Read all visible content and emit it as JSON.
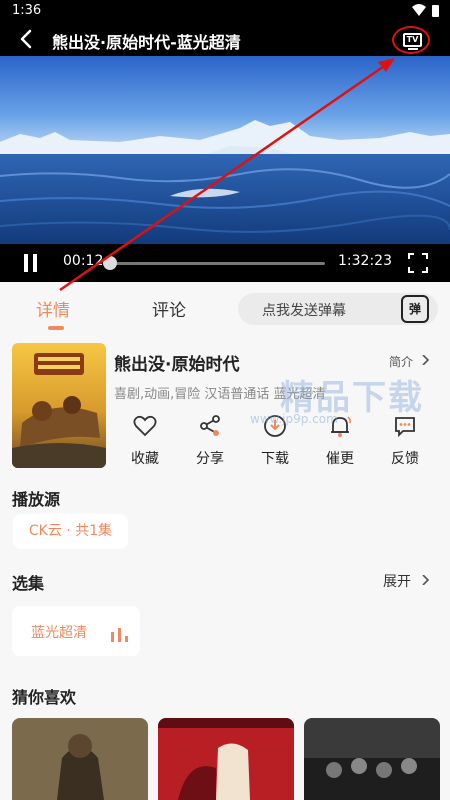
{
  "status_bar": {
    "time": "1:36"
  },
  "header": {
    "title": "熊出没·原始时代-蓝光超清",
    "cast_icon_text": "TV"
  },
  "player": {
    "current_time": "00:12",
    "total_time": "1:32:23",
    "progress_fraction": 0.0022
  },
  "tabs": [
    {
      "label": "详情",
      "active": true
    },
    {
      "label": "评论",
      "active": false
    }
  ],
  "danmaku": {
    "placeholder": "点我发送弹幕",
    "icon_text": "弹"
  },
  "movie": {
    "title": "熊出没·原始时代",
    "intro_label": "简介",
    "genres": "喜剧,动画,冒险 汉语普通话 蓝光超清"
  },
  "actions": [
    {
      "label": "收藏",
      "icon": "heart-icon"
    },
    {
      "label": "分享",
      "icon": "share-icon"
    },
    {
      "label": "下载",
      "icon": "download-icon"
    },
    {
      "label": "催更",
      "icon": "bell-icon"
    },
    {
      "label": "反馈",
      "icon": "feedback-icon"
    }
  ],
  "sources": {
    "heading": "播放源",
    "chip": "CK云 · 共1集"
  },
  "episodes": {
    "heading": "选集",
    "expand_label": "展开",
    "item": "蓝光超清"
  },
  "recommend": {
    "heading": "猜你喜欢"
  },
  "watermark": {
    "text": "精品下载",
    "url": "www.jp9p.com"
  },
  "colors": {
    "accent": "#f08a5d",
    "annotation": "#e01010"
  }
}
